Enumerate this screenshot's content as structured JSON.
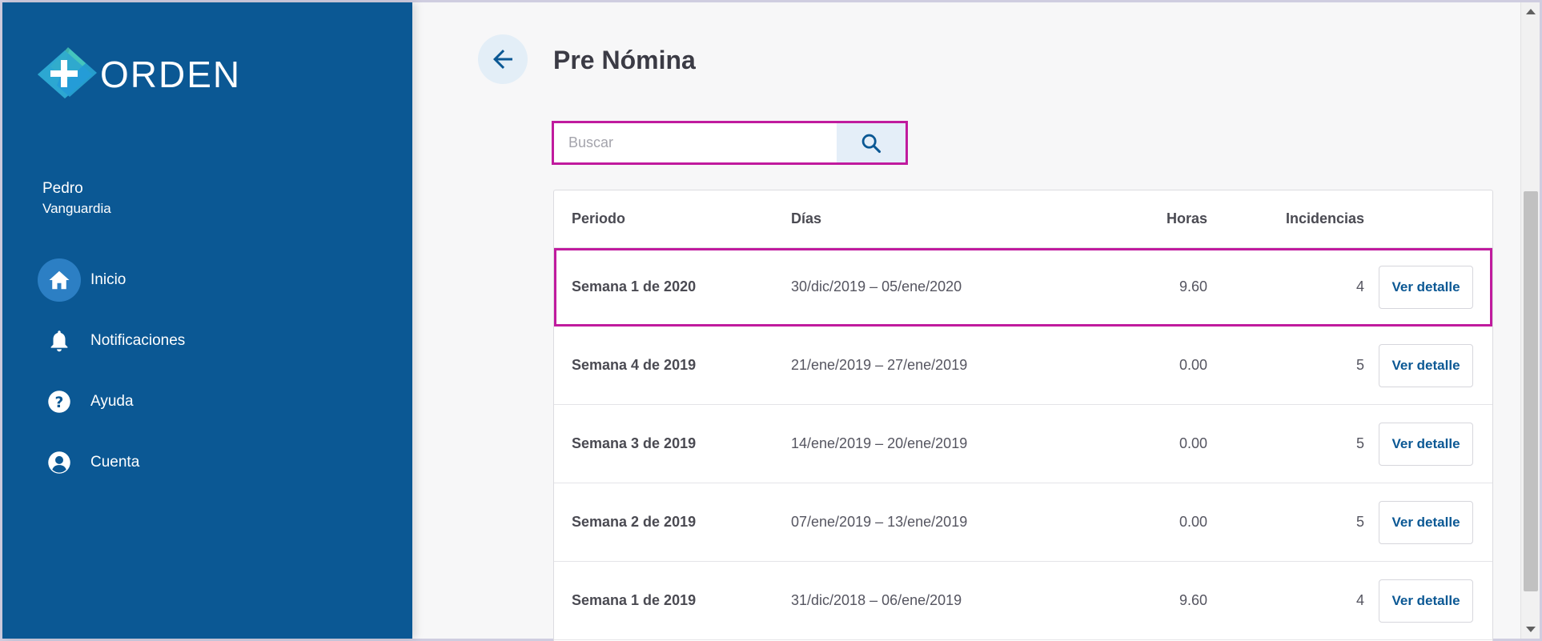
{
  "app": {
    "logo_text": "ORDEN",
    "logo_icon": "plus-diamond-logo"
  },
  "user": {
    "first_name": "Pedro",
    "last_name": "Vanguardia"
  },
  "nav": {
    "items": [
      {
        "label": "Inicio",
        "icon": "home-icon",
        "active": true
      },
      {
        "label": "Notificaciones",
        "icon": "bell-icon"
      },
      {
        "label": "Ayuda",
        "icon": "help-icon"
      },
      {
        "label": "Cuenta",
        "icon": "account-icon"
      }
    ]
  },
  "page": {
    "title": "Pre Nómina",
    "back_icon": "arrow-left-icon"
  },
  "search": {
    "placeholder": "Buscar",
    "value": "",
    "icon": "search-icon"
  },
  "table": {
    "headers": {
      "period": "Periodo",
      "days": "Días",
      "hours": "Horas",
      "incidents": "Incidencias"
    },
    "rows": [
      {
        "period": "Semana 1 de 2020",
        "days": "30/dic/2019 – 05/ene/2020",
        "hours": "9.60",
        "incidents": "4",
        "action": "Ver detalle"
      },
      {
        "period": "Semana 4 de 2019",
        "days": "21/ene/2019 – 27/ene/2019",
        "hours": "0.00",
        "incidents": "5",
        "action": "Ver detalle"
      },
      {
        "period": "Semana 3 de 2019",
        "days": "14/ene/2019 – 20/ene/2019",
        "hours": "0.00",
        "incidents": "5",
        "action": "Ver detalle"
      },
      {
        "period": "Semana 2 de 2019",
        "days": "07/ene/2019 – 13/ene/2019",
        "hours": "0.00",
        "incidents": "5",
        "action": "Ver detalle"
      },
      {
        "period": "Semana 1 de 2019",
        "days": "31/dic/2018 – 06/ene/2019",
        "hours": "9.60",
        "incidents": "4",
        "action": "Ver detalle"
      }
    ]
  },
  "colors": {
    "sidebar": "#0b5894",
    "accent": "#0b5894",
    "highlight": "#c01b9e"
  }
}
